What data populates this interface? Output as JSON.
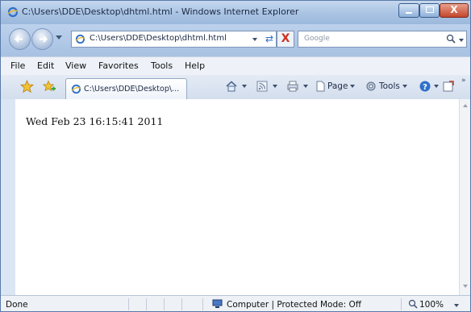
{
  "window": {
    "title": "C:\\Users\\DDE\\Desktop\\dhtml.html - Windows Internet Explorer",
    "minimize_icon": "minimize-icon",
    "maximize_icon": "maximize-icon",
    "close_label": "X"
  },
  "address_bar": {
    "url": "C:\\Users\\DDE\\Desktop\\dhtml.html",
    "refresh_icon": "refresh-icon",
    "stop_label": "X"
  },
  "search": {
    "placeholder": "Google"
  },
  "menu": {
    "items": [
      "File",
      "Edit",
      "View",
      "Favorites",
      "Tools",
      "Help"
    ]
  },
  "tab": {
    "label": "C:\\Users\\DDE\\Desktop\\..."
  },
  "command_bar": {
    "page_label": "Page",
    "tools_label": "Tools",
    "more_label": "»"
  },
  "content": {
    "date_text": "Wed Feb 23 16:15:41 2011"
  },
  "status_bar": {
    "status": "Done",
    "zone": "Computer | Protected Mode: Off",
    "zoom": "100%"
  },
  "colors": {
    "title_gradient_top": "#c6d8ee",
    "close_button": "#c4462c",
    "accent": "#2f6fc8"
  }
}
